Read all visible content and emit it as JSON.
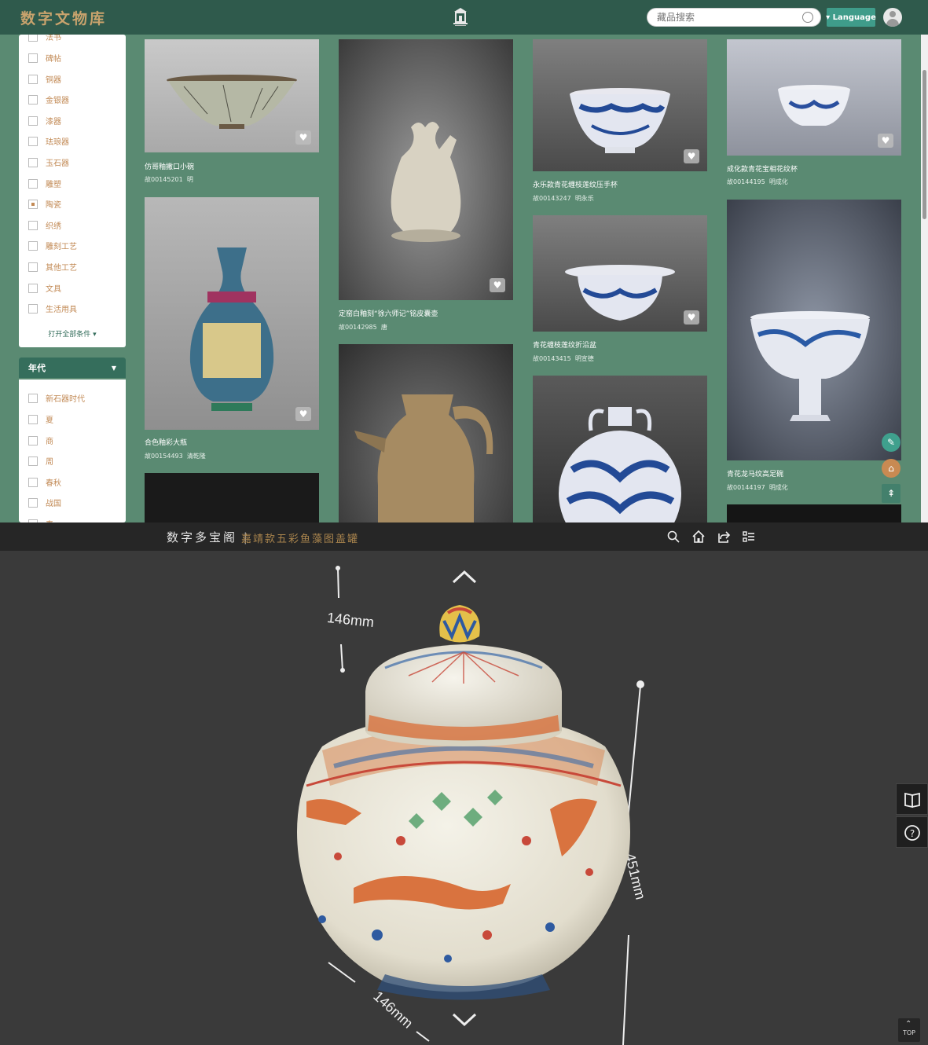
{
  "header": {
    "logo": "数字文物库",
    "search_placeholder": "藏品搜索",
    "language_label": "Language"
  },
  "filter_category": {
    "items": [
      {
        "label": "法书",
        "checked": false
      },
      {
        "label": "碑帖",
        "checked": false
      },
      {
        "label": "铜器",
        "checked": false
      },
      {
        "label": "金银器",
        "checked": false
      },
      {
        "label": "漆器",
        "checked": false
      },
      {
        "label": "珐琅器",
        "checked": false
      },
      {
        "label": "玉石器",
        "checked": false
      },
      {
        "label": "雕塑",
        "checked": false
      },
      {
        "label": "陶瓷",
        "checked": true
      },
      {
        "label": "织绣",
        "checked": false
      },
      {
        "label": "雕刻工艺",
        "checked": false
      },
      {
        "label": "其他工艺",
        "checked": false
      },
      {
        "label": "文具",
        "checked": false
      },
      {
        "label": "生活用具",
        "checked": false
      }
    ],
    "open_all": "打开全部条件"
  },
  "filter_era": {
    "title": "年代",
    "items": [
      {
        "label": "新石器时代"
      },
      {
        "label": "夏"
      },
      {
        "label": "商"
      },
      {
        "label": "周"
      },
      {
        "label": "春秋"
      },
      {
        "label": "战国"
      },
      {
        "label": "秦"
      }
    ]
  },
  "cards": [
    {
      "title": "仿哥釉撇口小碗",
      "id": "故00145201",
      "era": "明"
    },
    {
      "title": "合色釉彩大瓶",
      "id": "故00154493",
      "era": "清乾隆"
    },
    {
      "title": "定窑白釉刻“徐六师记”铭皮囊壶",
      "id": "故00142985",
      "era": "唐"
    },
    {
      "title": "永乐款青花缠枝莲纹压手杯",
      "id": "故00143247",
      "era": "明永乐"
    },
    {
      "title": "青花缠枝莲纹折沿盆",
      "id": "故00143415",
      "era": "明宣德"
    },
    {
      "title": "成化款青花宝相花纹杯",
      "id": "故00144195",
      "era": "明成化"
    },
    {
      "title": "青花龙马纹高足碗",
      "id": "故00144197",
      "era": "明成化"
    }
  ],
  "viewer": {
    "brand": "数字多宝阁",
    "object_title": "嘉靖款五彩鱼藻图盖罐",
    "dim_top": "146mm",
    "dim_height": "451mm",
    "dim_width": "146mm",
    "top_button": "TOP"
  },
  "colors": {
    "header_bg": "#2f5a4c",
    "page_bg": "#5a8a72",
    "accent_gold": "#c9a36d",
    "viewer_bg": "#3a3a3a"
  }
}
